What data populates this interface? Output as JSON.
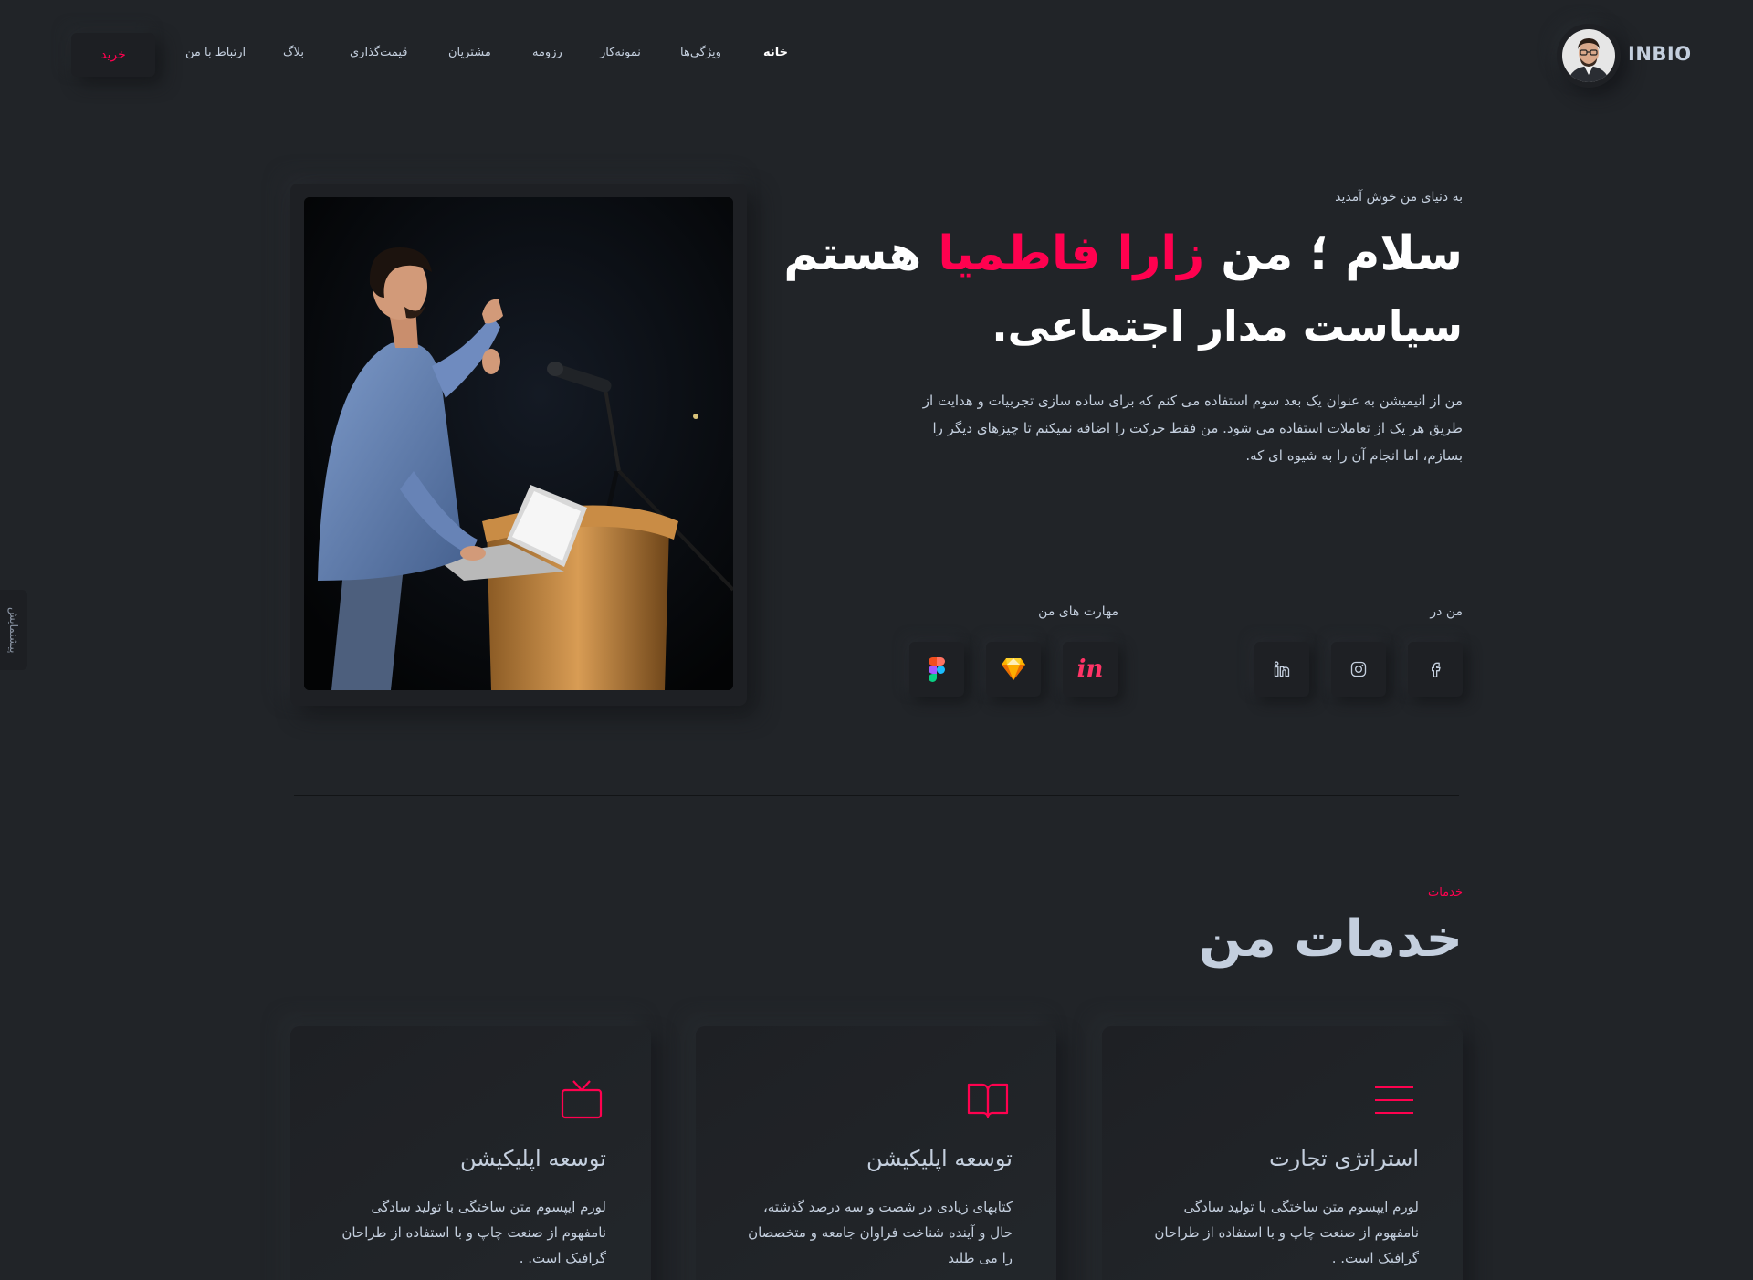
{
  "header": {
    "brand": "INBIO",
    "nav": [
      "خانه",
      "ویژگی‌ها",
      "نمونه‌کار",
      "رزومه",
      "مشتریان",
      "قیمت‌گذاری",
      "بلاگ",
      "ارتباط با من"
    ],
    "buy_button": "خرید"
  },
  "side_tab": "پیشنمایش",
  "hero": {
    "welcome": "به دنیای من خوش آمدید",
    "title_prefix": "سلام ؛ من ",
    "title_name": "زارا فاطمیا",
    "title_suffix": " هستم",
    "subtitle": "سیاست مدار اجتماعی.",
    "description": "من از انیمیشن به عنوان یک بعد سوم استفاده می کنم که برای ساده سازی تجربیات و هدایت از طریق هر یک از تعاملات استفاده می شود. من فقط حرکت را اضافه نمیکنم تا چیزهای دیگر را بسازم، اما انجام آن را به شیوه ای که.",
    "find_me_label": "من در",
    "skills_label": "مهارت های من",
    "social_icons": [
      "facebook-icon",
      "instagram-icon",
      "linkedin-icon"
    ],
    "skill_icons": [
      "invision-icon",
      "sketch-icon",
      "figma-icon"
    ]
  },
  "services": {
    "tag": "خدمات",
    "title": "خدمات من",
    "cards": [
      {
        "icon": "menu-lines-icon",
        "title": "استراتژی تجارت",
        "description": "لورم ایپسوم متن ساختگی با تولید سادگی نامفهوم از صنعت چاپ و با استفاده از طراحان گرافیک است. ."
      },
      {
        "icon": "book-icon",
        "title": "توسعه اپلیکیشن",
        "description": "کتابهای زیادی در شصت و سه درصد گذشته، حال و آینده شناخت فراوان جامعه و متخصصان را می طلبد"
      },
      {
        "icon": "tv-icon",
        "title": "توسعه اپلیکیشن",
        "description": "لورم ایپسوم متن ساختگی با تولید سادگی نامفهوم از صنعت چاپ و با استفاده از طراحان گرافیک است. ."
      }
    ]
  },
  "colors": {
    "background": "#212428",
    "accent": "#ff014f",
    "text": "#c4cfde"
  }
}
